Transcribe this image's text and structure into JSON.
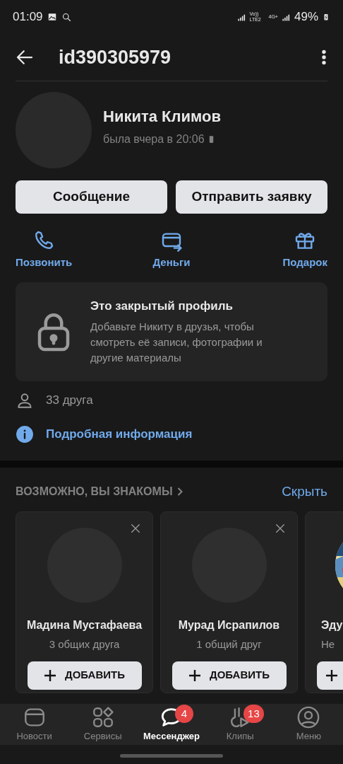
{
  "status_bar": {
    "time": "01:09",
    "network": "Vo)) LTE2",
    "data": "4G+",
    "battery": "49%"
  },
  "header": {
    "title": "id390305979"
  },
  "profile": {
    "name": "Никита Климов",
    "last_seen": "была вчера в 20:06"
  },
  "primary_buttons": [
    "Сообщение",
    "Отправить заявку"
  ],
  "actions": [
    {
      "kind": "call",
      "label": "Позвонить"
    },
    {
      "kind": "money",
      "label": "Деньги"
    },
    {
      "kind": "gift",
      "label": "Подарок"
    }
  ],
  "closed_profile": {
    "title": "Это закрытый профиль",
    "text": "Добавьте Никиту в друзья, чтобы смотреть её записи, фотографии и другие материалы"
  },
  "info_rows": [
    {
      "kind": "friends",
      "label": "33 друга"
    },
    {
      "kind": "info",
      "label": "Подробная информация"
    }
  ],
  "suggestions": {
    "title": "ВОЗМОЖНО, ВЫ ЗНАКОМЫ",
    "hide": "Скрыть",
    "cards": [
      {
        "name": "Мадина Мустафаева",
        "mutual": "3 общих друга",
        "button": "ДОБАВИТЬ"
      },
      {
        "name": "Мурад Исрапилов",
        "mutual": "1 общий друг",
        "button": "ДОБАВИТЬ"
      },
      {
        "name": "Эду",
        "mutual": "Не",
        "kind": "picture"
      }
    ]
  },
  "nav": [
    {
      "kind": "news",
      "label": "Новости",
      "selected": false
    },
    {
      "kind": "services",
      "label": "Сервисы",
      "selected": false
    },
    {
      "kind": "messenger",
      "label": "Мессенджер",
      "selected": true,
      "badge": "4"
    },
    {
      "kind": "clips",
      "label": "Клипы",
      "selected": false,
      "badge": "13"
    },
    {
      "kind": "menu",
      "label": "Меню",
      "selected": false
    }
  ]
}
